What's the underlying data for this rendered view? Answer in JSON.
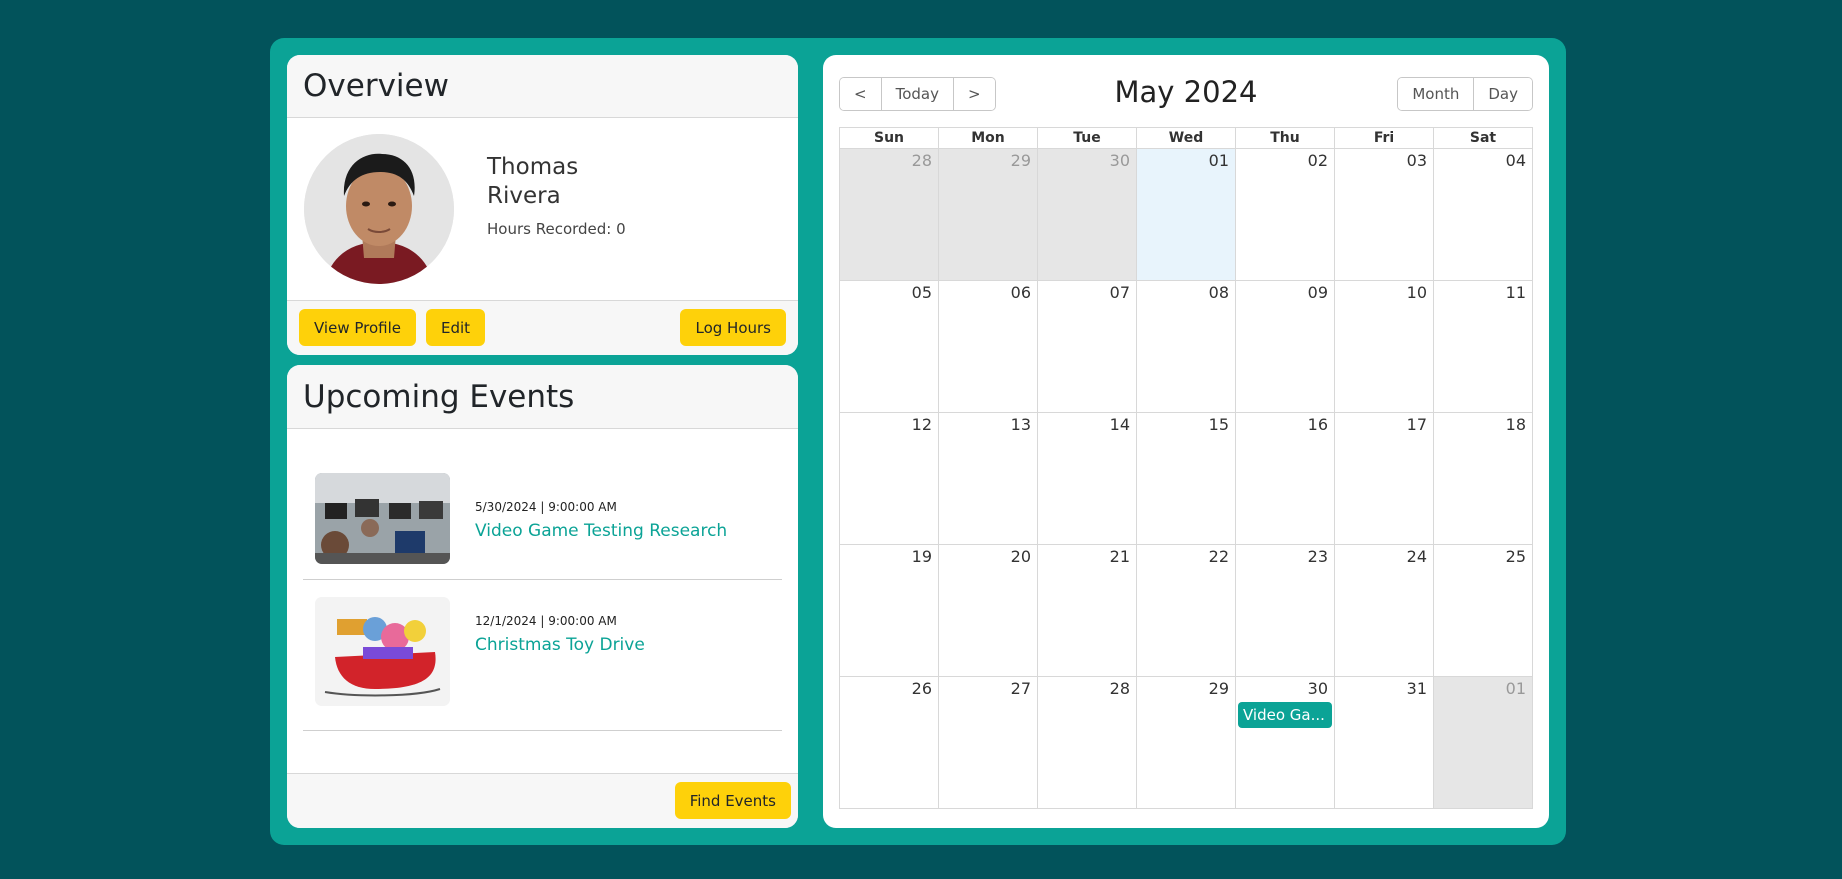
{
  "overview": {
    "title": "Overview",
    "first_name": "Thomas",
    "last_name": "Rivera",
    "hours_label": "Hours Recorded: 0",
    "buttons": {
      "view_profile": "View Profile",
      "edit": "Edit",
      "log_hours": "Log Hours"
    }
  },
  "events": {
    "title": "Upcoming Events",
    "items": [
      {
        "date": "5/30/2024 | 9:00:00 AM",
        "title": "Video Game Testing Research"
      },
      {
        "date": "12/1/2024 | 9:00:00 AM",
        "title": "Christmas Toy Drive"
      }
    ],
    "find_button": "Find Events"
  },
  "calendar": {
    "title": "May 2024",
    "nav": {
      "prev": "<",
      "today": "Today",
      "next": ">"
    },
    "views": {
      "month": "Month",
      "day": "Day"
    },
    "days_of_week": [
      "Sun",
      "Mon",
      "Tue",
      "Wed",
      "Thu",
      "Fri",
      "Sat"
    ],
    "weeks": [
      [
        "28",
        "29",
        "30",
        "01",
        "02",
        "03",
        "04"
      ],
      [
        "05",
        "06",
        "07",
        "08",
        "09",
        "10",
        "11"
      ],
      [
        "12",
        "13",
        "14",
        "15",
        "16",
        "17",
        "18"
      ],
      [
        "19",
        "20",
        "21",
        "22",
        "23",
        "24",
        "25"
      ],
      [
        "26",
        "27",
        "28",
        "29",
        "30",
        "31",
        "01"
      ]
    ],
    "event_label": "Video Ga..."
  },
  "colors": {
    "background": "#02535b",
    "accent": "#0ba396",
    "button": "#fed10a"
  }
}
